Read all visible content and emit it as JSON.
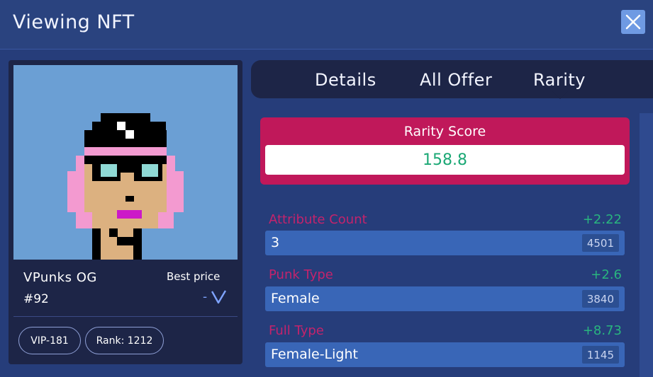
{
  "modal": {
    "title": "Viewing NFT",
    "close_icon": "close-icon"
  },
  "nft": {
    "name": "VPunks OG",
    "number": "#92",
    "best_price_label": "Best price",
    "price": "-",
    "currency_icon": "vechain-v-icon",
    "badges": {
      "standard": "VIP-181",
      "rank": "Rank: 1212"
    }
  },
  "tabs": [
    {
      "label": "Details"
    },
    {
      "label": "All Offer"
    },
    {
      "label": "Rarity",
      "active": true
    }
  ],
  "rarity": {
    "title": "Rarity Score",
    "score": "158.8"
  },
  "attributes": [
    {
      "label": "Attribute Count",
      "delta": "+2.22",
      "value": "3",
      "count": "4501"
    },
    {
      "label": "Punk Type",
      "delta": "+2.6",
      "value": "Female",
      "count": "3840"
    },
    {
      "label": "Full Type",
      "delta": "+8.73",
      "value": "Female-Light",
      "count": "1145"
    }
  ],
  "colors": {
    "background": "#263d7a",
    "panel": "#1d2547",
    "rarity_accent": "#c0185a",
    "positive": "#29b57f",
    "attr_bar": "#3966b7"
  }
}
